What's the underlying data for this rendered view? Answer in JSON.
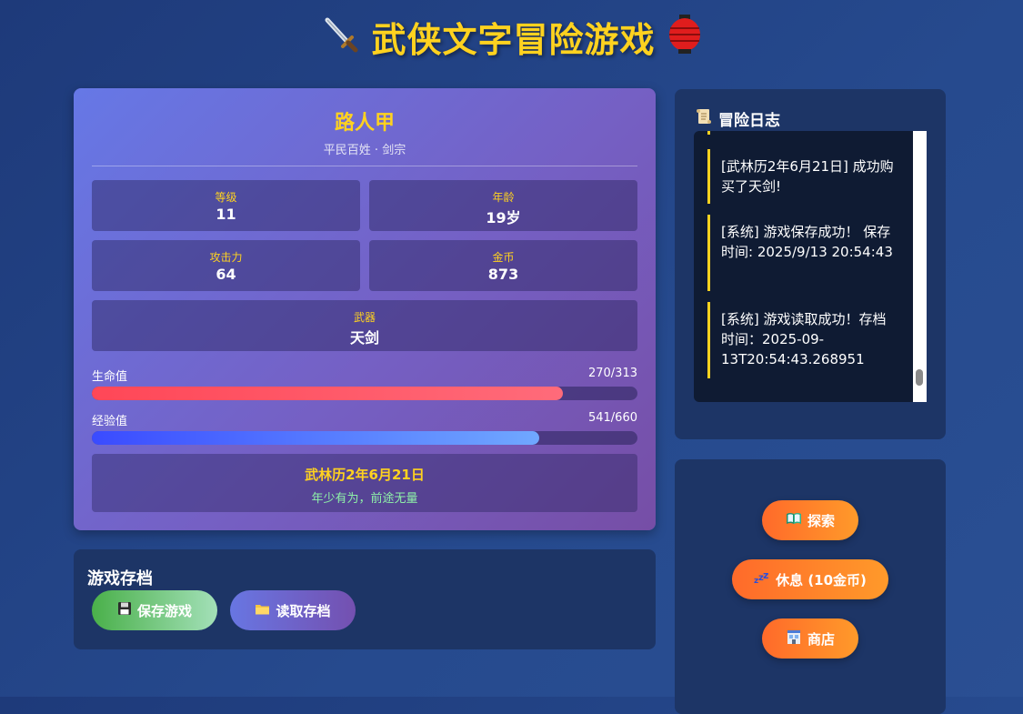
{
  "page": {
    "title": "武侠文字冒险游戏",
    "title_icon_left": "sword-icon",
    "title_icon_right": "lantern-icon"
  },
  "character": {
    "name": "路人甲",
    "subtitle": "平民百姓 · 剑宗",
    "stats": {
      "level_label": "等级",
      "level_value": "11",
      "age_label": "年龄",
      "age_value": "19岁",
      "attack_label": "攻击力",
      "attack_value": "64",
      "gold_label": "金币",
      "gold_value": "873",
      "weapon_label": "武器",
      "weapon_value": "天剑"
    },
    "hp": {
      "label": "生命值",
      "text": "270/313",
      "current": 270,
      "max": 313
    },
    "xp": {
      "label": "经验值",
      "text": "541/660",
      "current": 541,
      "max": 660
    },
    "date": "武林历2年6月21日",
    "status": "年少有为，前途无量"
  },
  "save": {
    "title": "游戏存档",
    "save_label": "保存游戏",
    "save_icon": "floppy-disk-icon",
    "load_label": "读取存档",
    "load_icon": "folder-icon"
  },
  "log": {
    "title": "冒险日志",
    "title_icon": "scroll-icon",
    "entries": [
      "[武林历2年6月21日] 成功购买了天剑!",
      "[系统] 游戏保存成功！ 保存时间: 2025/9/13 20:54:43",
      "[系统] 游戏读取成功！存档时间：2025-09-13T20:54:43.268951"
    ]
  },
  "actions": {
    "explore_label": "探索",
    "explore_icon": "book-icon",
    "rest_label": "休息 (10金币)",
    "rest_icon": "sleep-icon",
    "shop_label": "商店",
    "shop_icon": "shop-icon"
  },
  "colors": {
    "accent": "#ffd21f",
    "hp": "#ff4757",
    "xp": "#3a4bff",
    "action": "#ff7a2a"
  }
}
